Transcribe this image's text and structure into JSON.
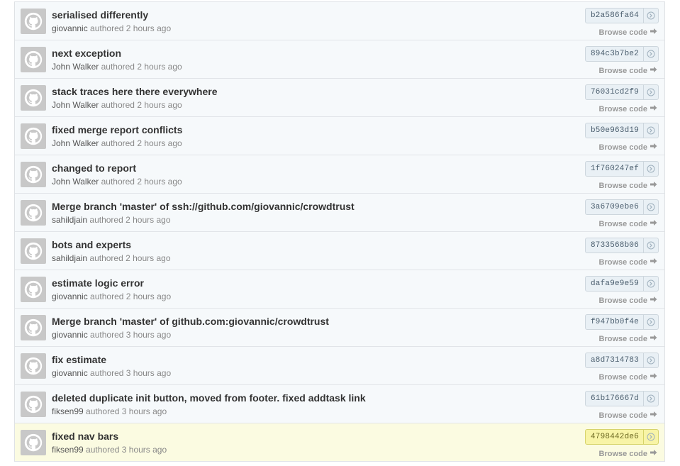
{
  "commits": [
    {
      "title": "serialised differently",
      "author": "giovannic",
      "action": "authored",
      "time": "2 hours ago",
      "sha": "b2a586fa64",
      "browse_label": "Browse code"
    },
    {
      "title": "next exception",
      "author": "John Walker",
      "action": "authored",
      "time": "2 hours ago",
      "sha": "894c3b7be2",
      "browse_label": "Browse code"
    },
    {
      "title": "stack traces here there everywhere",
      "author": "John Walker",
      "action": "authored",
      "time": "2 hours ago",
      "sha": "76031cd2f9",
      "browse_label": "Browse code"
    },
    {
      "title": "fixed merge report conflicts",
      "author": "John Walker",
      "action": "authored",
      "time": "2 hours ago",
      "sha": "b50e963d19",
      "browse_label": "Browse code"
    },
    {
      "title": "changed to report",
      "author": "John Walker",
      "action": "authored",
      "time": "2 hours ago",
      "sha": "1f760247ef",
      "browse_label": "Browse code"
    },
    {
      "title": "Merge branch 'master' of ssh://github.com/giovannic/crowdtrust",
      "author": "sahildjain",
      "action": "authored",
      "time": "2 hours ago",
      "sha": "3a6709ebe6",
      "browse_label": "Browse code"
    },
    {
      "title": "bots and experts",
      "author": "sahildjain",
      "action": "authored",
      "time": "2 hours ago",
      "sha": "8733568b06",
      "browse_label": "Browse code"
    },
    {
      "title": "estimate logic error",
      "author": "giovannic",
      "action": "authored",
      "time": "2 hours ago",
      "sha": "dafa9e9e59",
      "browse_label": "Browse code"
    },
    {
      "title": "Merge branch 'master' of github.com:giovannic/crowdtrust",
      "author": "giovannic",
      "action": "authored",
      "time": "3 hours ago",
      "sha": "f947bb0f4e",
      "browse_label": "Browse code"
    },
    {
      "title": "fix estimate",
      "author": "giovannic",
      "action": "authored",
      "time": "3 hours ago",
      "sha": "a8d7314783",
      "browse_label": "Browse code"
    },
    {
      "title": "deleted duplicate init button, moved from footer. fixed addtask link",
      "author": "fiksen99",
      "action": "authored",
      "time": "3 hours ago",
      "sha": "61b176667d",
      "browse_label": "Browse code"
    },
    {
      "title": "fixed nav bars",
      "author": "fiksen99",
      "action": "authored",
      "time": "3 hours ago",
      "sha": "4798442de6",
      "browse_label": "Browse code",
      "highlighted": true
    }
  ],
  "icons": {
    "avatar": "octocat-avatar-icon",
    "sha_arrow": "arrow-right-circle-icon",
    "browse_arrow": "arrow-right-icon"
  },
  "colors": {
    "row_background": "#f6f9fb",
    "highlight_background": "#fbfbe1",
    "title_text": "#333333",
    "meta_text": "#888888"
  }
}
